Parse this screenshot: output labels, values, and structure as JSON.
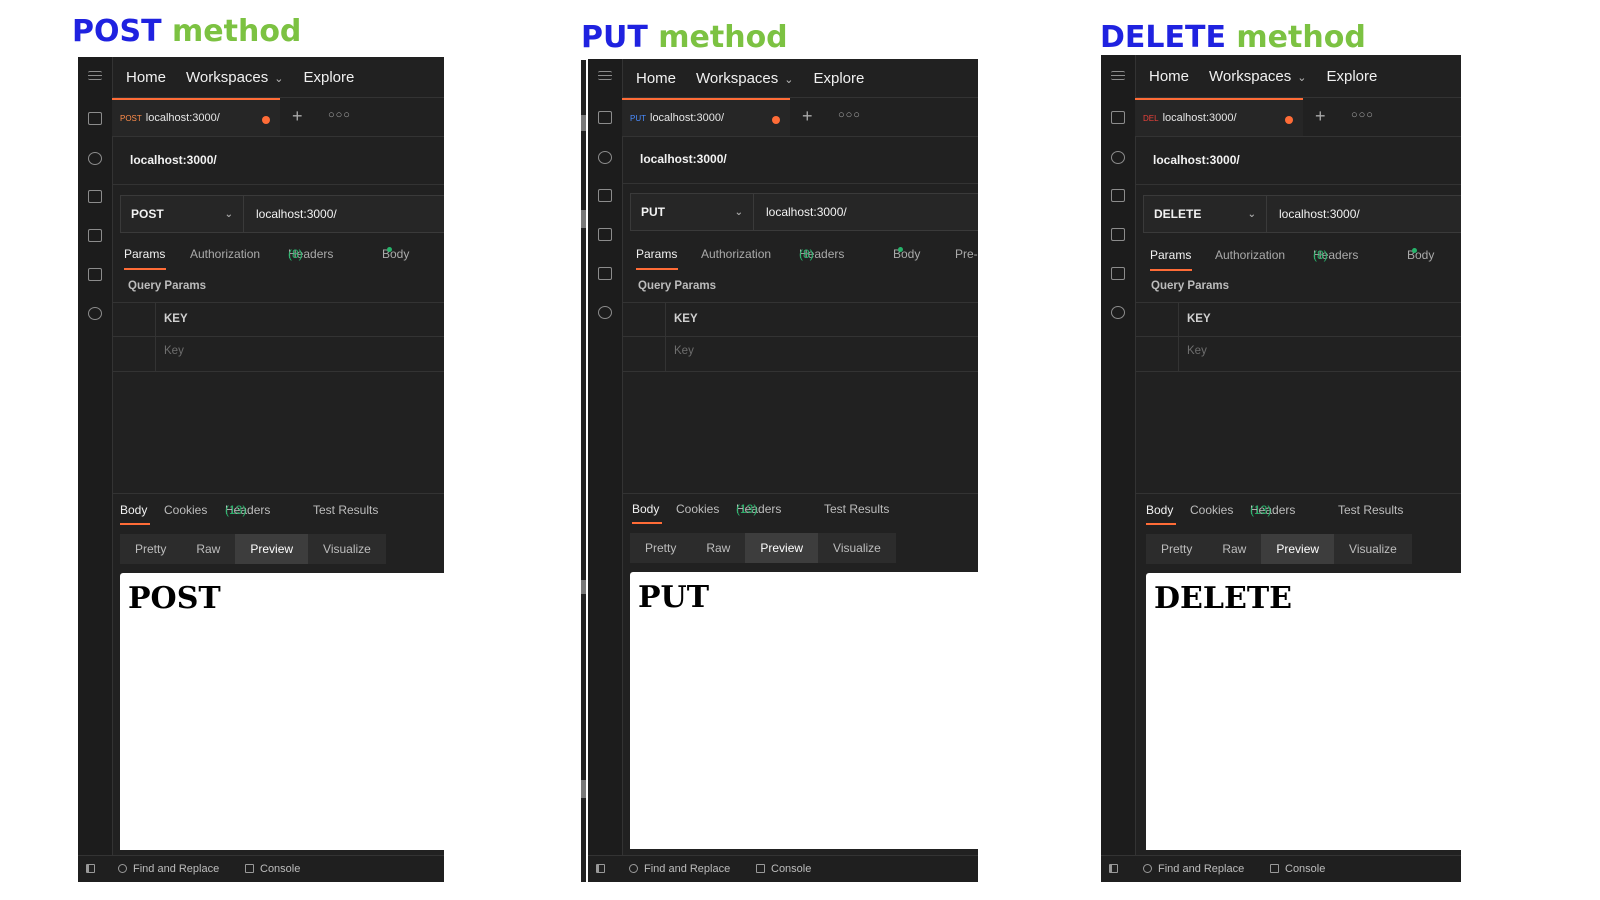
{
  "panels": [
    {
      "caption": {
        "method": "POST",
        "word": "method"
      },
      "nav": {
        "home": "Home",
        "workspaces": "Workspaces",
        "explore": "Explore"
      },
      "tab": {
        "verb": "POST",
        "verb_color": "#ff8c4a",
        "title": "localhost:3000/"
      },
      "request_name": "localhost:3000/",
      "method": "POST",
      "url": "localhost:3000/",
      "req_tabs": {
        "params": "Params",
        "authorization": "Authorization",
        "headers": "Headers",
        "headers_count": "(8)",
        "body": "Body",
        "pre": ""
      },
      "query_params": "Query Params",
      "key_header": "KEY",
      "key_placeholder": "Key",
      "resp_tabs": {
        "body": "Body",
        "cookies": "Cookies",
        "headers": "Headers",
        "headers_count": "(13)",
        "tests": "Test Results"
      },
      "view_modes": [
        "Pretty",
        "Raw",
        "Preview",
        "Visualize"
      ],
      "selected_view": "Preview",
      "preview_text": "POST",
      "status": {
        "find": "Find and Replace",
        "console": "Console"
      }
    },
    {
      "caption": {
        "method": "PUT",
        "word": "method"
      },
      "nav": {
        "home": "Home",
        "workspaces": "Workspaces",
        "explore": "Explore"
      },
      "tab": {
        "verb": "PUT",
        "verb_color": "#4a8cff",
        "title": "localhost:3000/"
      },
      "request_name": "localhost:3000/",
      "method": "PUT",
      "url": "localhost:3000/",
      "req_tabs": {
        "params": "Params",
        "authorization": "Authorization",
        "headers": "Headers",
        "headers_count": "(8)",
        "body": "Body",
        "pre": "Pre-"
      },
      "query_params": "Query Params",
      "key_header": "KEY",
      "key_placeholder": "Key",
      "resp_tabs": {
        "body": "Body",
        "cookies": "Cookies",
        "headers": "Headers",
        "headers_count": "(13)",
        "tests": "Test Results"
      },
      "view_modes": [
        "Pretty",
        "Raw",
        "Preview",
        "Visualize"
      ],
      "selected_view": "Preview",
      "preview_text": "PUT",
      "status": {
        "find": "Find and Replace",
        "console": "Console"
      }
    },
    {
      "caption": {
        "method": "DELETE",
        "word": "method"
      },
      "nav": {
        "home": "Home",
        "workspaces": "Workspaces",
        "explore": "Explore"
      },
      "tab": {
        "verb": "DEL",
        "verb_color": "#e8413a",
        "title": "localhost:3000/"
      },
      "request_name": "localhost:3000/",
      "method": "DELETE",
      "url": "localhost:3000/",
      "req_tabs": {
        "params": "Params",
        "authorization": "Authorization",
        "headers": "Headers",
        "headers_count": "(8)",
        "body": "Body",
        "pre": ""
      },
      "query_params": "Query Params",
      "key_header": "KEY",
      "key_placeholder": "Key",
      "resp_tabs": {
        "body": "Body",
        "cookies": "Cookies",
        "headers": "Headers",
        "headers_count": "(13)",
        "tests": "Test Results"
      },
      "view_modes": [
        "Pretty",
        "Raw",
        "Preview",
        "Visualize"
      ],
      "selected_view": "Preview",
      "preview_text": "DELETE",
      "status": {
        "find": "Find and Replace",
        "console": "Console"
      }
    }
  ],
  "colors": {
    "accent": "#ff6c37",
    "caption_method": "#1f22e0",
    "caption_word": "#7cc242",
    "body_dot": "#26b36a"
  }
}
